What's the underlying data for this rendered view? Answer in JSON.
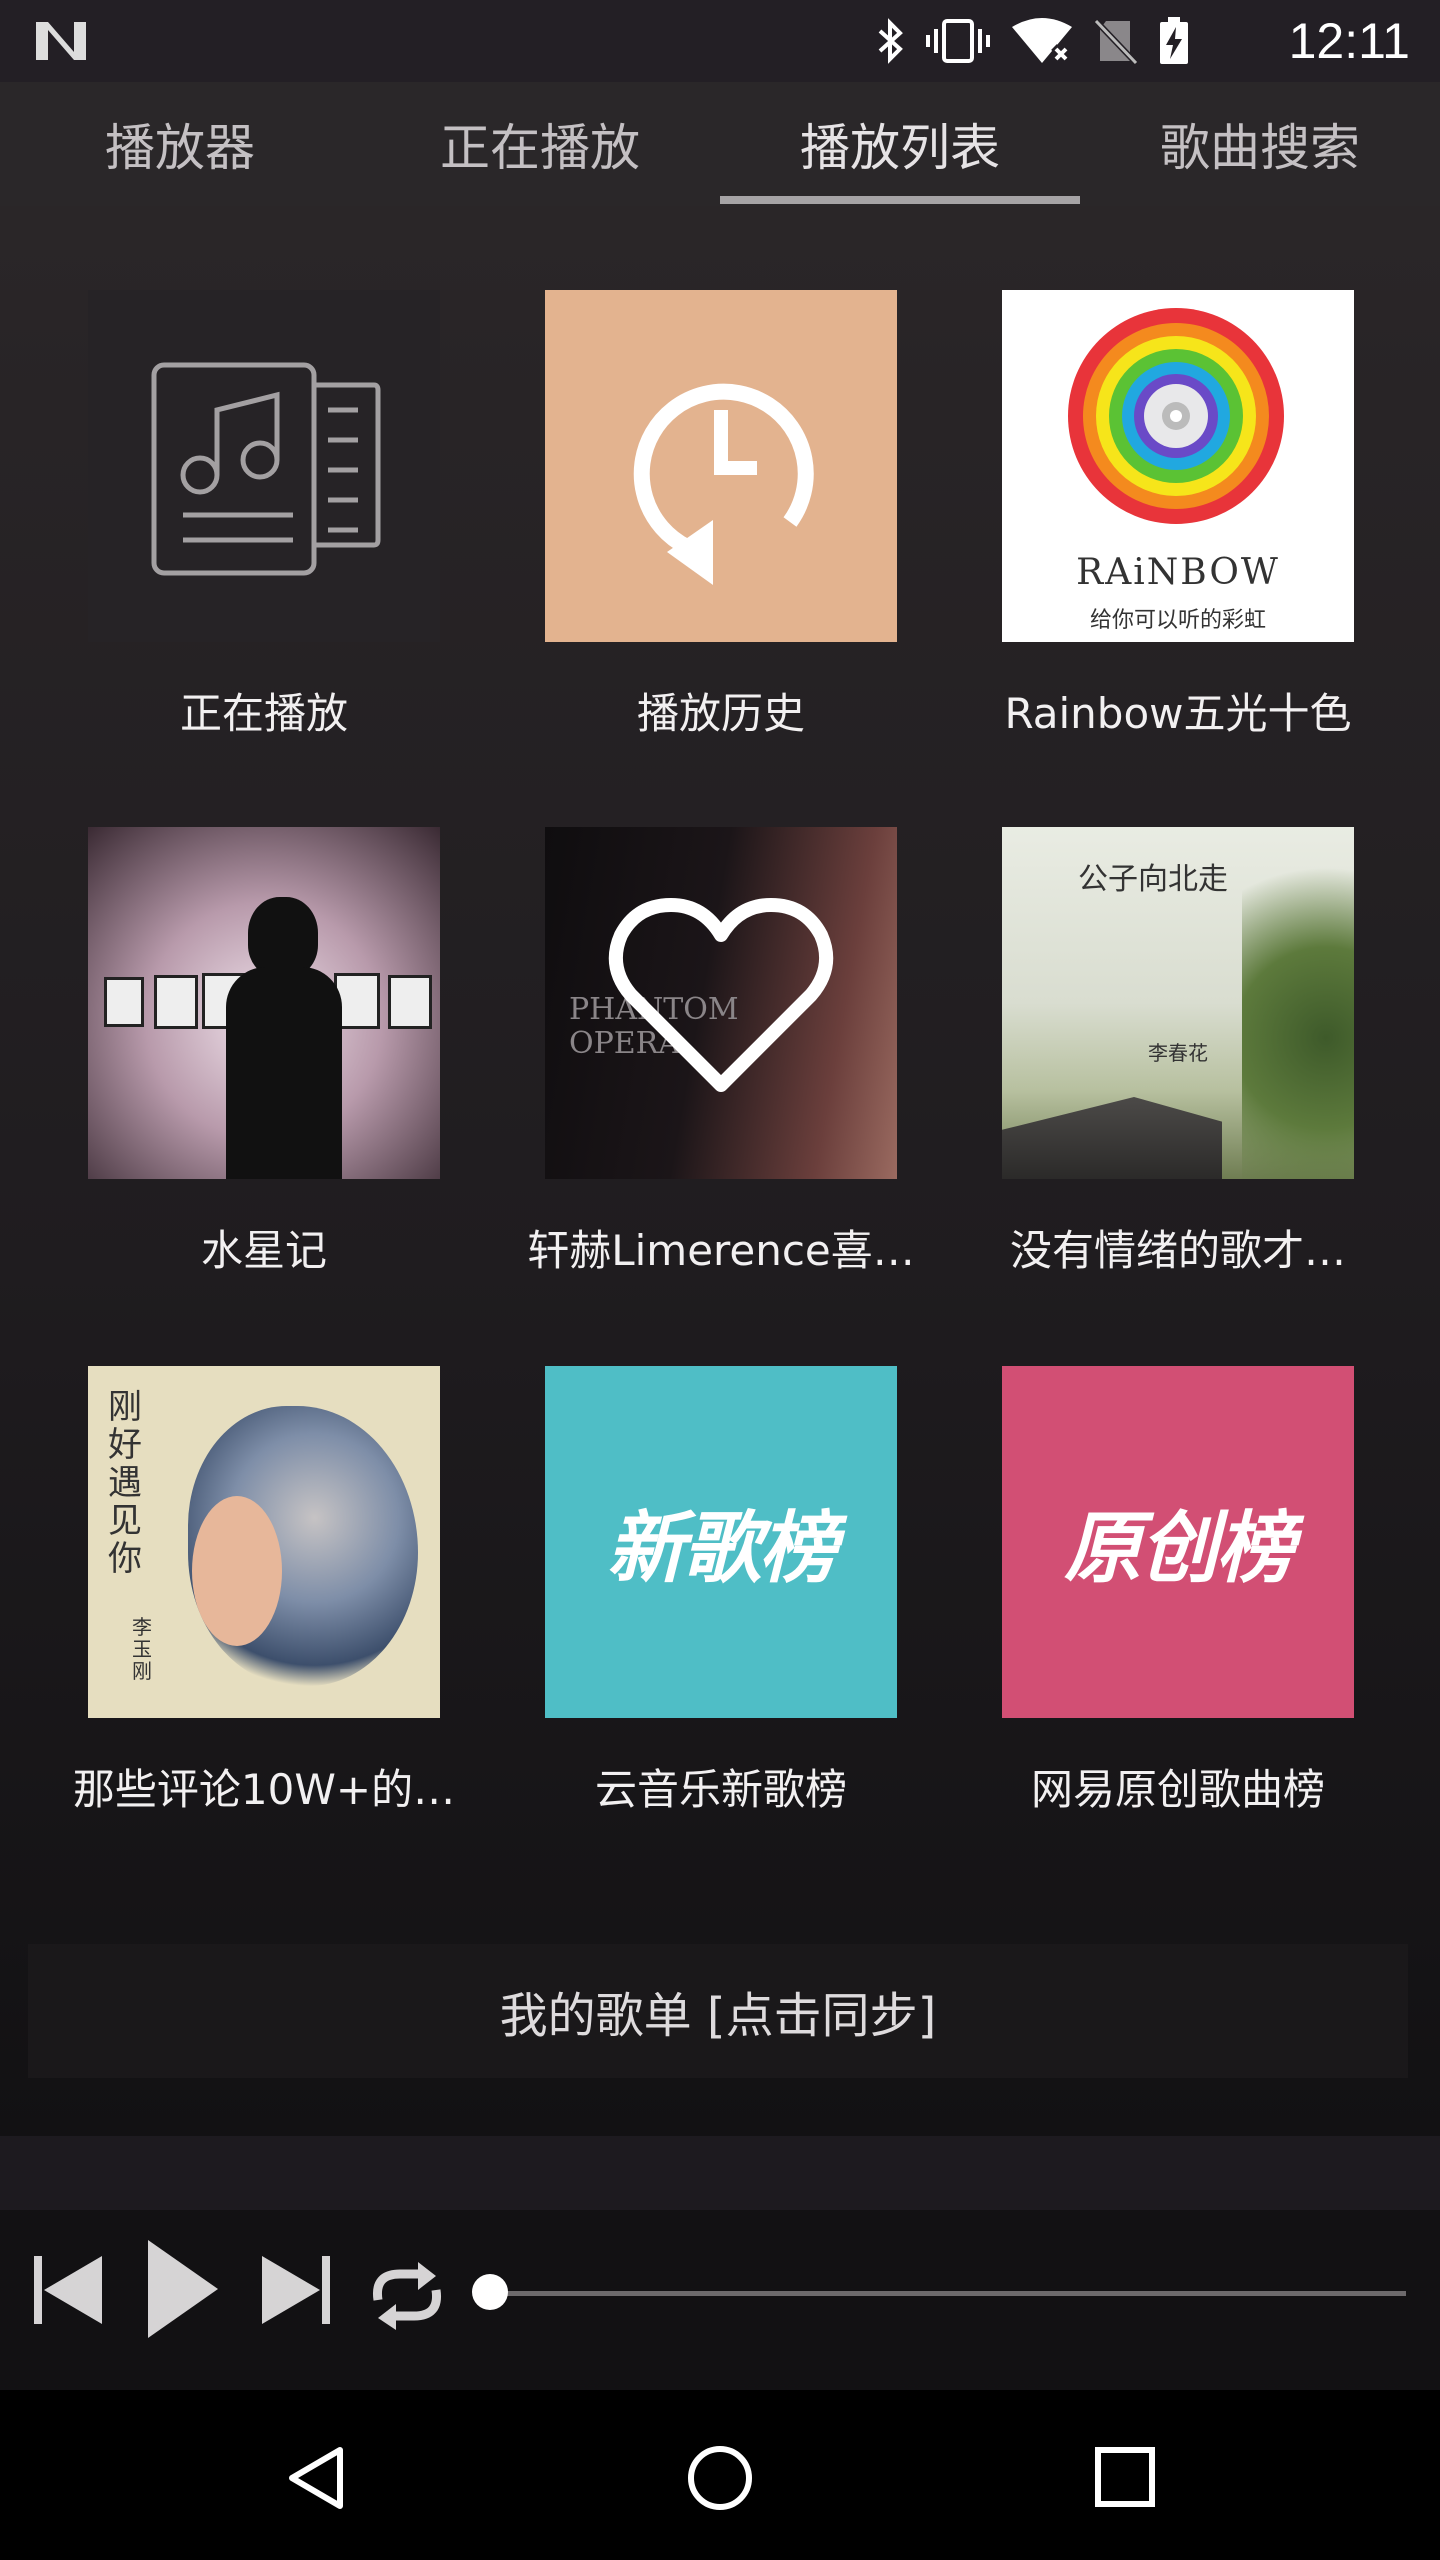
{
  "status_bar": {
    "time": "12:11",
    "icons": [
      "bluetooth-icon",
      "vibrate-icon",
      "wifi-icon",
      "no-sim-icon",
      "battery-charging-icon"
    ]
  },
  "tabs": [
    {
      "label": "播放器",
      "active": false
    },
    {
      "label": "正在播放",
      "active": false
    },
    {
      "label": "播放列表",
      "active": true
    },
    {
      "label": "歌曲搜索",
      "active": false
    }
  ],
  "playlists": [
    {
      "label": "正在播放",
      "icon": "now-playing-icon"
    },
    {
      "label": "播放历史",
      "icon": "history-icon"
    },
    {
      "label": "Rainbow五光十色",
      "cover_title": "RAiNBOW",
      "cover_subtitle": "给你可以听的彩虹"
    },
    {
      "label": "水星记"
    },
    {
      "label": "轩赫Limerence喜…",
      "cover_title": "PHANTOM OPERA",
      "icon": "heart-icon"
    },
    {
      "label": "没有情绪的歌才…",
      "cover_title": "公子向北走",
      "cover_artist": "李春花"
    },
    {
      "label": "那些评论10W+的…",
      "cover_title": "刚好遇见你",
      "cover_artist": "李玉刚"
    },
    {
      "label": "云音乐新歌榜",
      "cover_title": "新歌榜"
    },
    {
      "label": "网易原创歌曲榜",
      "cover_title": "原创榜"
    }
  ],
  "sync_label": "我的歌单 [点击同步]",
  "player": {
    "progress": 0,
    "controls": [
      "previous-icon",
      "play-icon",
      "next-icon",
      "repeat-icon"
    ]
  },
  "colors": {
    "history_cover": "#e3b38f",
    "new_chart_cover": "#4fbec6",
    "original_chart_cover": "#d24f74"
  }
}
